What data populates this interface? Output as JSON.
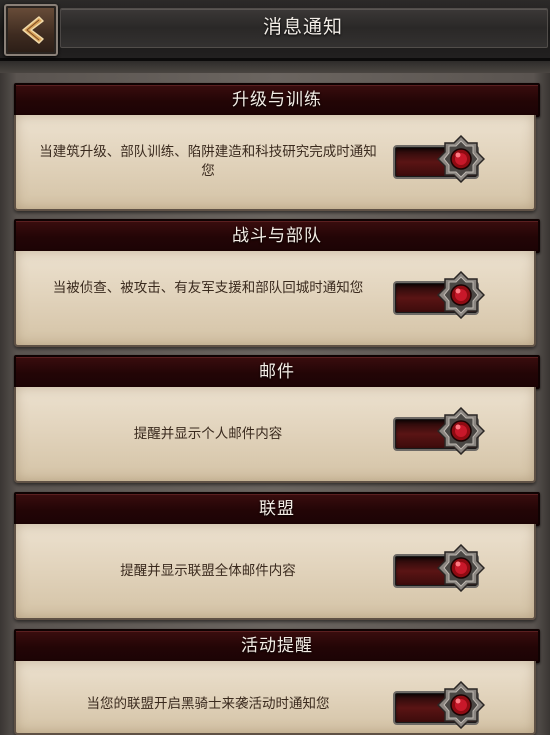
{
  "header": {
    "title": "消息通知"
  },
  "sections": [
    {
      "title": "升级与训练",
      "description": "当建筑升级、部队训练、陷阱建造和科技研究完成时通知您",
      "enabled": true
    },
    {
      "title": "战斗与部队",
      "description": "当被侦查、被攻击、有友军支援和部队回城时通知您",
      "enabled": true
    },
    {
      "title": "邮件",
      "description": "提醒并显示个人邮件内容",
      "enabled": true
    },
    {
      "title": "联盟",
      "description": "提醒并显示联盟全体邮件内容",
      "enabled": true
    },
    {
      "title": "活动提醒",
      "description": "当您的联盟开启黑骑士来袭活动时通知您",
      "enabled": true
    }
  ],
  "icons": {
    "back": "back-arrow-icon",
    "toggle_knob": "red-gem-knob-icon"
  },
  "colors": {
    "toggle_on": "#b0101a",
    "section_header": "#230506",
    "card_bg": "#e2d4bd"
  }
}
